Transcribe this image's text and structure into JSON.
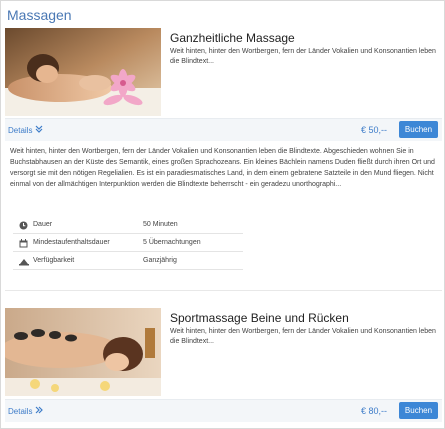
{
  "section": {
    "title": "Massagen"
  },
  "offers": [
    {
      "name": "Ganzheitliche Massage",
      "teaser": "Weit hinten, hinter den Wortbergen, fern der Länder Vokalien und Konsonantien leben die Blindtext...",
      "details_label": "Details",
      "details_icon": "chevron-double-down-icon",
      "price": "€ 50,--",
      "book_label": "Buchen",
      "description": "Weit hinten, hinter den Wortbergen, fern der Länder Vokalien und Konsonantien leben die Blindtexte. Abgeschieden wohnen Sie in Buchstabhausen an der Küste des Semantik, eines großen Sprachozeans. Ein kleines Bächlein namens Duden fließt durch ihren Ort und versorgt sie mit den nötigen Regelialien. Es ist ein paradiesmatisches Land, in dem einem gebratene Satzteile in den Mund fliegen. Nicht einmal von der allmächtigen Interpunktion werden die Blindtexte beherrscht - ein geradezu unorthographi...",
      "facts": [
        {
          "icon": "clock-icon",
          "label": "Dauer",
          "value": "50 Minuten"
        },
        {
          "icon": "calendar-icon",
          "label": "Mindestaufenthaltsdauer",
          "value": "5 Übernachtungen"
        },
        {
          "icon": "availability-icon",
          "label": "Verfügbarkeit",
          "value": "Ganzjährig"
        }
      ]
    },
    {
      "name": "Sportmassage Beine und Rücken",
      "teaser": "Weit hinten, hinter den Wortbergen, fern der Länder Vokalien und Konsonantien leben die Blindtext...",
      "details_label": "Details",
      "details_icon": "chevron-double-right-icon",
      "price": "€ 80,--",
      "book_label": "Buchen"
    }
  ],
  "colors": {
    "accent": "#3d87d6",
    "link": "#3d7cc9",
    "title": "#4a78b4",
    "bar_bg": "#f3f6f9"
  }
}
